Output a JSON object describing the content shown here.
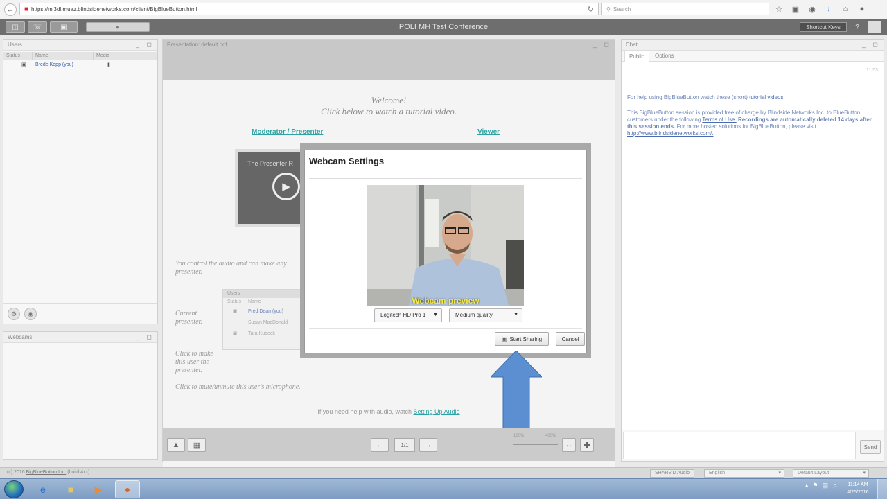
{
  "browser": {
    "url": "https://mi3dl.muaz.blindsidenetworks.com/client/BigBlueButton.html",
    "search_placeholder": "Search",
    "icons": [
      "back-icon",
      "site-icon",
      "reload-icon",
      "star-icon",
      "reading-icon",
      "pocket-icon",
      "download-icon",
      "home-icon",
      "menu-icon"
    ]
  },
  "toolbar": {
    "title": "POLI MH Test Conference",
    "shortcut_label": "Shortcut Keys",
    "help_label": "?"
  },
  "users_panel": {
    "title": "Users",
    "columns": [
      "Status",
      "Name",
      "Media"
    ],
    "rows": [
      {
        "name": "Brede Kopp (you)"
      }
    ]
  },
  "webcam_panel": {
    "title": "Webcams"
  },
  "presentation": {
    "title": "Presentation: default.pdf",
    "welcome_line1": "Welcome!",
    "welcome_line2": "Click below to watch a tutorial video.",
    "moderator_link": "Moderator / Presenter",
    "viewer_link": "Viewer",
    "video_text": "The Presenter R",
    "audio_text_1": "You control the audio and can make any",
    "audio_text_2": "presenter.",
    "current_presenter_1": "Current",
    "current_presenter_2": "presenter.",
    "click_make_1": "Click to make",
    "click_make_2": "this user the",
    "click_make_3": "presenter.",
    "mute_text": "Click to mute/unmute this user's microphone.",
    "mini_title": "Users",
    "mini_status": "Status",
    "mini_name": "Name",
    "mini_users": [
      "Fred Dean (you)",
      "Susan MacDonald",
      "Tara Kubeck"
    ],
    "help_audio_prefix": "If you need help with audio, watch",
    "help_audio_link": "Setting Up Audio",
    "page_label": "1/1",
    "zoom_min": "100%",
    "zoom_max": "400%"
  },
  "chat": {
    "title": "Chat",
    "tabs": [
      "Public",
      "Options"
    ],
    "time": "11:53",
    "msg1_prefix": "For help using BigBlueButton watch these (short)",
    "msg1_link": "tutorial videos.",
    "msg2_a": "This BigBlueButton session is provided free of charge by Blindside Networks Inc. to",
    "msg2_b": "BlueButton customers under the following",
    "msg2_terms": "Terms of Use.",
    "msg2_c": "Recordings are",
    "msg2_d": "automatically deleted 14 days after this session ends.",
    "msg2_e": "For more hosted solutions",
    "msg2_f": "for BigBlueButton, please visit",
    "msg2_link": "http://www.blindsidenetworks.com/.",
    "send_label": "Send"
  },
  "status_bar": {
    "copyright_prefix": "(c) 2016",
    "copyright_link": "BigBlueButton Inc.",
    "copyright_suffix": "(build 4xx)",
    "audio_pill": "SHARE'D Audio",
    "language": "English",
    "layout": "Default Layout"
  },
  "taskbar": {
    "apps": [
      "start-orb",
      "ie-icon",
      "explorer-icon",
      "media-player-icon",
      "firefox-icon"
    ],
    "time": "11:14 AM",
    "date": "4/25/2016"
  },
  "modal": {
    "title": "Webcam Settings",
    "preview_caption": "Webcam preview",
    "camera": "Logitech HD Pro 1",
    "quality": "Medium quality",
    "start_label": "Start Sharing",
    "cancel_label": "Cancel"
  },
  "colors": {
    "arrow": "#5b8fd1",
    "teal_link": "#2fa3a3",
    "preview_caption": "#f6e94a"
  }
}
